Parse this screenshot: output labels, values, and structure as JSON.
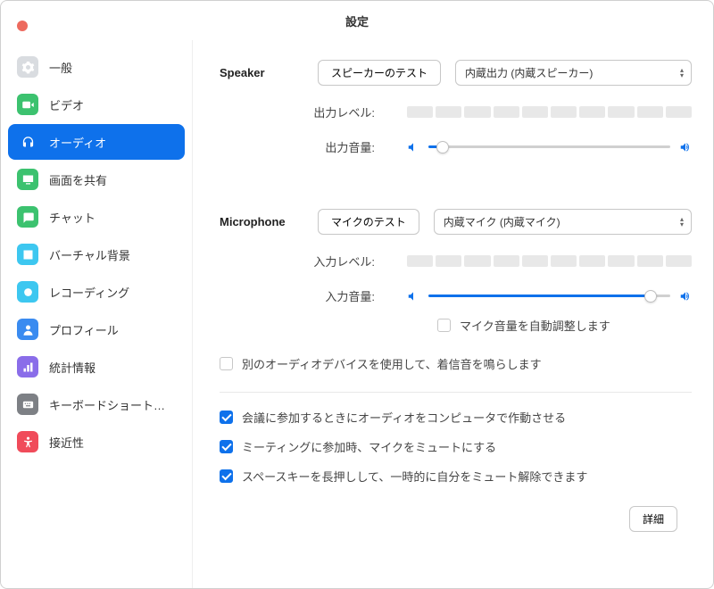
{
  "title": "設定",
  "sidebar": {
    "items": [
      {
        "label": "一般",
        "active": false
      },
      {
        "label": "ビデオ",
        "active": false
      },
      {
        "label": "オーディオ",
        "active": true
      },
      {
        "label": "画面を共有",
        "active": false
      },
      {
        "label": "チャット",
        "active": false
      },
      {
        "label": "バーチャル背景",
        "active": false
      },
      {
        "label": "レコーディング",
        "active": false
      },
      {
        "label": "プロフィール",
        "active": false
      },
      {
        "label": "統計情報",
        "active": false
      },
      {
        "label": "キーボードショートカ…",
        "active": false
      },
      {
        "label": "接近性",
        "active": false
      }
    ]
  },
  "speaker": {
    "section_label": "Speaker",
    "test_button": "スピーカーのテスト",
    "device_selected": "内蔵出力 (内蔵スピーカー)",
    "output_level_label": "出力レベル:",
    "output_volume_label": "出力音量:",
    "volume_pct": 6
  },
  "microphone": {
    "section_label": "Microphone",
    "test_button": "マイクのテスト",
    "device_selected": "内蔵マイク (内蔵マイク)",
    "input_level_label": "入力レベル:",
    "input_volume_label": "入力音量:",
    "volume_pct": 92,
    "auto_volume": {
      "checked": false,
      "label": "マイク音量を自動調整します"
    }
  },
  "options": {
    "separate_ringtone": {
      "checked": false,
      "label": "別のオーディオデバイスを使用して、着信音を鳴らします"
    },
    "computer_audio_on_join": {
      "checked": true,
      "label": "会議に参加するときにオーディオをコンピュータで作動させる"
    },
    "mute_on_join": {
      "checked": true,
      "label": "ミーティングに参加時、マイクをミュートにする"
    },
    "space_to_unmute": {
      "checked": true,
      "label": "スペースキーを長押しして、一時的に自分をミュート解除できます"
    }
  },
  "advanced_button": "詳細"
}
